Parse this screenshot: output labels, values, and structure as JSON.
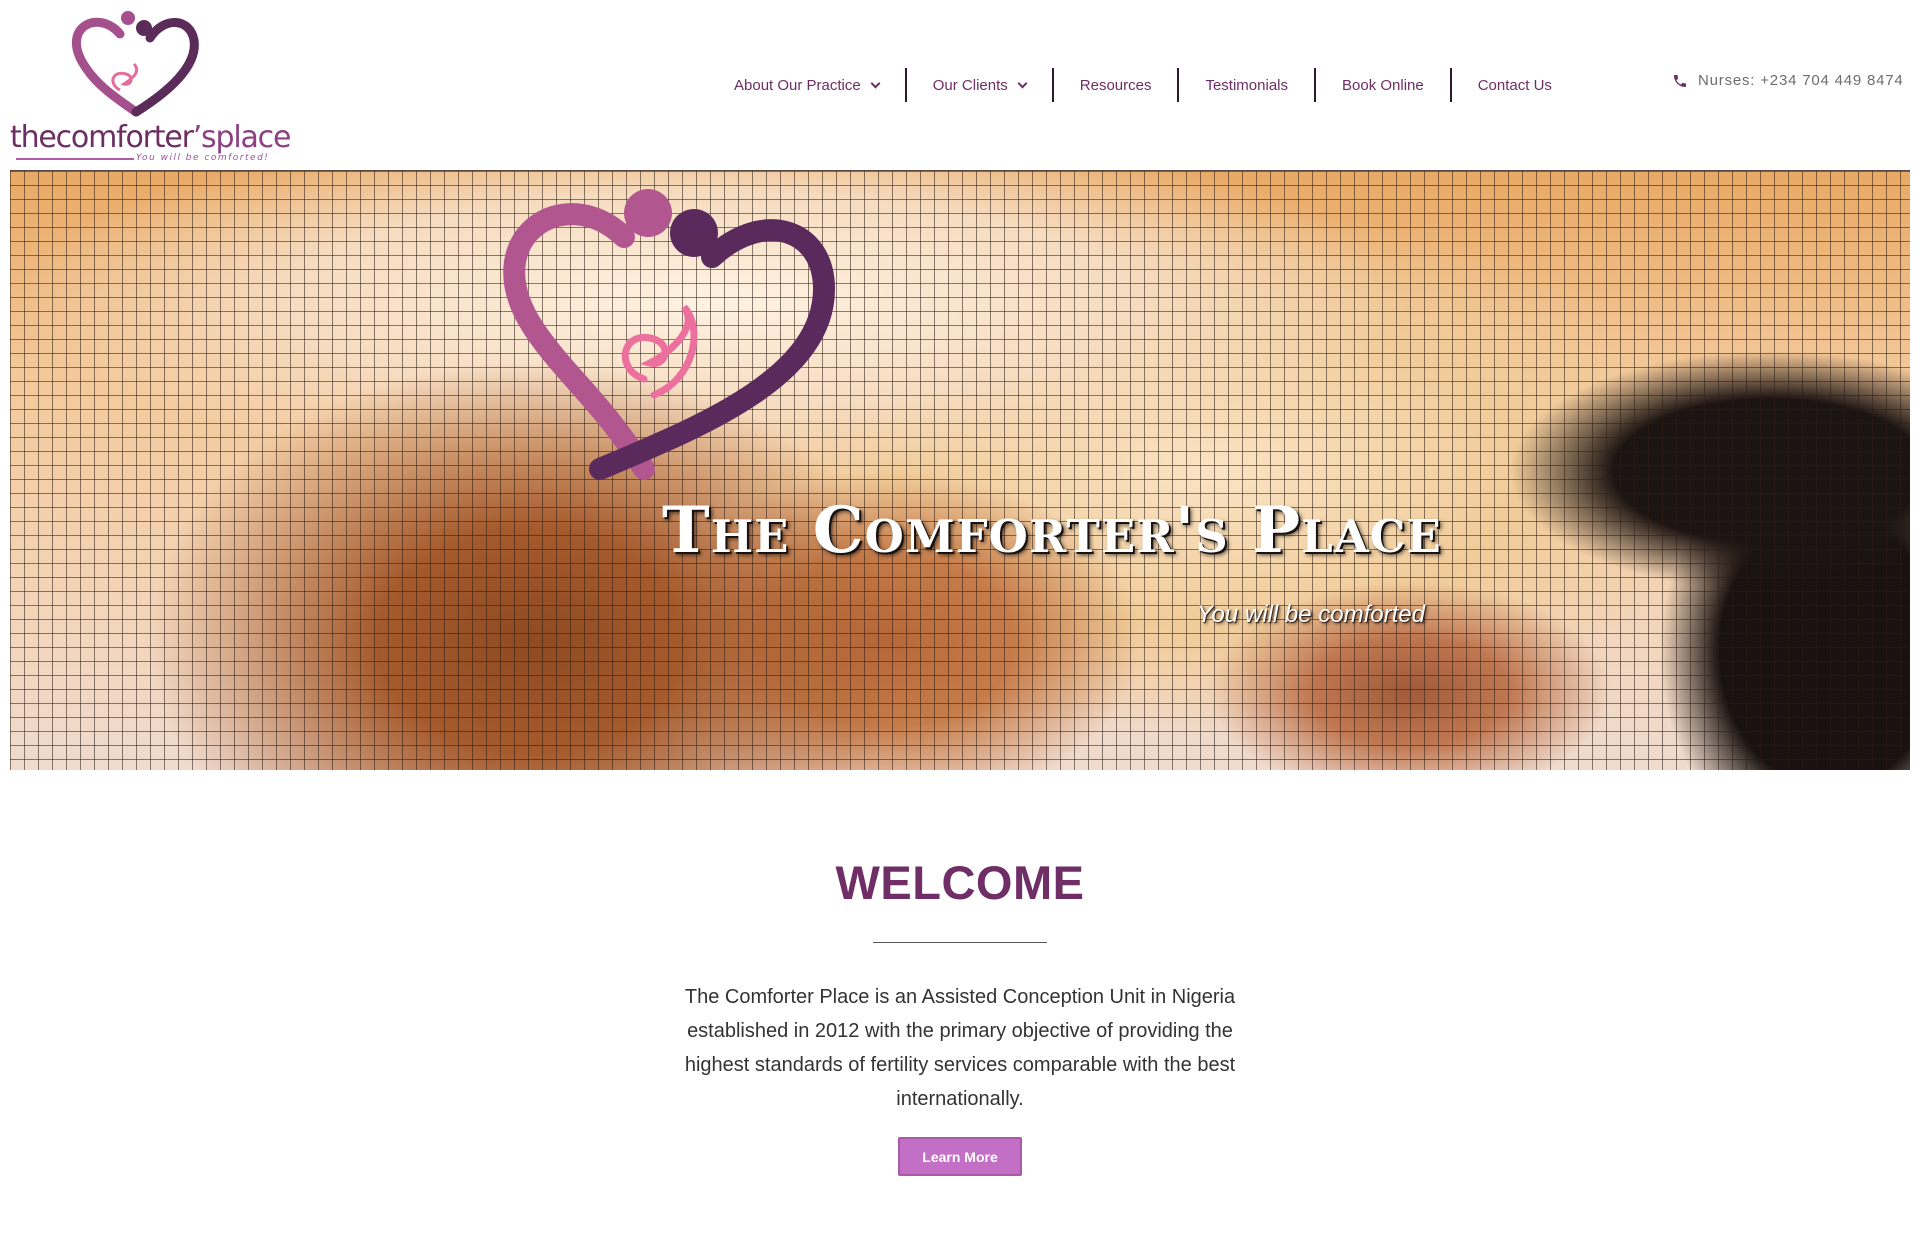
{
  "brand": {
    "logo_word_part1": "thecomforter",
    "logo_word_part2": "’splace",
    "logo_tagline": "You will be comforted!"
  },
  "nav": {
    "items": [
      {
        "label": "About Our Practice",
        "has_dropdown": true
      },
      {
        "label": "Our Clients",
        "has_dropdown": true
      },
      {
        "label": "Resources",
        "has_dropdown": false
      },
      {
        "label": "Testimonials",
        "has_dropdown": false
      },
      {
        "label": "Book Online",
        "has_dropdown": false
      },
      {
        "label": "Contact Us",
        "has_dropdown": false
      }
    ]
  },
  "contact": {
    "phone_icon": "phone-icon",
    "phone_text": "Nurses: +234 704 449 8474"
  },
  "hero": {
    "title": "The Comforter's Place",
    "subtitle": "You will be comforted"
  },
  "welcome": {
    "heading": "WELCOME",
    "body": "The Comforter Place is an Assisted Conception Unit in Nigeria established in 2012 with the primary objective of providing the highest standards of fertility services comparable with the best internationally.",
    "button_label": "Learn More"
  },
  "colors": {
    "brand_purple": "#6f2f66",
    "brand_mauve": "#a65a92",
    "brand_pink": "#e36d9c",
    "button_bg": "#c36fc5"
  }
}
